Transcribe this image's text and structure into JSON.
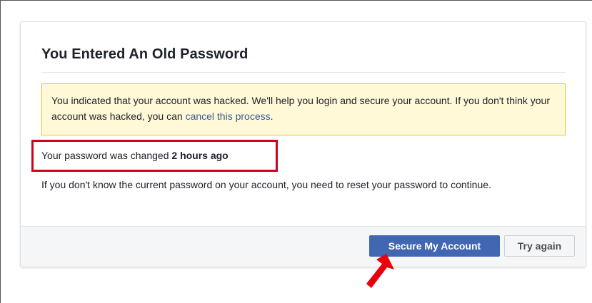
{
  "dialog": {
    "title": "You Entered An Old Password",
    "notice": {
      "text": "You indicated that your account was hacked. We'll help you login and secure your account. If you don't think your account was hacked, you can ",
      "link": "cancel this process",
      "suffix": "."
    },
    "changed": {
      "prefix": "Your password was changed ",
      "time": "2 hours ago"
    },
    "explanation": "If you don't know the current password on your account, you need to reset your password to continue.",
    "buttons": {
      "primary": "Secure My Account",
      "secondary": "Try again"
    }
  },
  "annotations": {
    "highlight_color": "#d0021b",
    "arrow_color": "#e8000b",
    "arrow_icon": "pointer-arrow-icon"
  },
  "colors": {
    "primary_button": "#4267b2",
    "notice_background": "#fff9d7",
    "notice_border": "#e2c822",
    "link": "#365899"
  }
}
